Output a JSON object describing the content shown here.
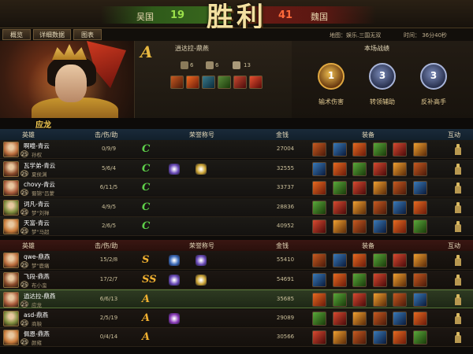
{
  "match": {
    "result_title": "胜利",
    "team_left": {
      "name": "吴国",
      "score": "19"
    },
    "team_right": {
      "name": "魏国",
      "score": "41"
    },
    "map": "地图：娱乐.三国无双",
    "time": "时间：  36分40秒"
  },
  "tabs": [
    "概览",
    "详细数据",
    "图表"
  ],
  "player": {
    "rank": "A",
    "name": "逍达拉-鼎燕",
    "stats": [
      {
        "icon": "sword-icon",
        "value": "6"
      },
      {
        "icon": "skull-icon",
        "value": "6"
      },
      {
        "icon": "handshake-icon",
        "value": "13"
      }
    ],
    "item_icons": [
      "boots-icon",
      "fire-blade-icon",
      "axe-icon",
      "dragon-icon",
      "crystal-icon",
      "phoenix-icon"
    ],
    "hero_name": "应龙"
  },
  "honors": {
    "title": "本场战绩",
    "medals": [
      {
        "label": "输术伤害",
        "number": "1"
      },
      {
        "label": "转领辅助",
        "number": "3"
      },
      {
        "label": "反补高手",
        "number": "3"
      }
    ]
  },
  "table_headers": {
    "hero": "英雄",
    "kda": "击/伤/助",
    "honor": "荣誉称号",
    "gold": "金钱",
    "equip": "装备",
    "interact": "互动"
  },
  "blue_team": [
    {
      "name": "啊噫-青云",
      "level": "25",
      "hero": "孙权",
      "kda": "0/9/9",
      "rank": "C",
      "gold": "27004"
    },
    {
      "name": "瓦学弟-青云",
      "level": "25",
      "hero": "夏侯渊",
      "kda": "5/6/4",
      "rank": "C",
      "gold": "32555"
    },
    {
      "name": "chovy-青云",
      "level": "25",
      "hero": "蜀锦\"吕蒙",
      "kda": "6/11/5",
      "rank": "C",
      "gold": "33737"
    },
    {
      "name": "词凡-青云",
      "level": "25",
      "hero": "梦\"刘禅",
      "kda": "4/9/5",
      "rank": "C",
      "gold": "28836"
    },
    {
      "name": "天富-青云",
      "level": "25",
      "hero": "梦\"马超",
      "kda": "2/6/5",
      "rank": "C",
      "gold": "40952"
    }
  ],
  "red_team": [
    {
      "name": "qwe-鼎燕",
      "level": "25",
      "hero": "梦\"鹿痛",
      "kda": "15/2/8",
      "rank": "S",
      "gold": "55410"
    },
    {
      "name": "飞段-鼎燕",
      "level": "25",
      "hero": "布小蛮",
      "kda": "17/2/7",
      "rank": "SS",
      "gold": "54691"
    },
    {
      "name": "逍达拉-鼎燕",
      "level": "25",
      "hero": "应龙",
      "kda": "6/6/13",
      "rank": "A",
      "gold": "35685"
    },
    {
      "name": "asd-鼎燕",
      "level": "25",
      "hero": "商鞅",
      "kda": "2/5/19",
      "rank": "A",
      "gold": "29089"
    },
    {
      "name": "佩恩-鼎燕",
      "level": "25",
      "hero": "颜雍",
      "kda": "0/4/14",
      "rank": "A",
      "gold": "30566"
    }
  ],
  "colors": {
    "accent_gold": "#f0c850",
    "win_green": "#9be04a",
    "loss_red": "#ff6a3a"
  }
}
